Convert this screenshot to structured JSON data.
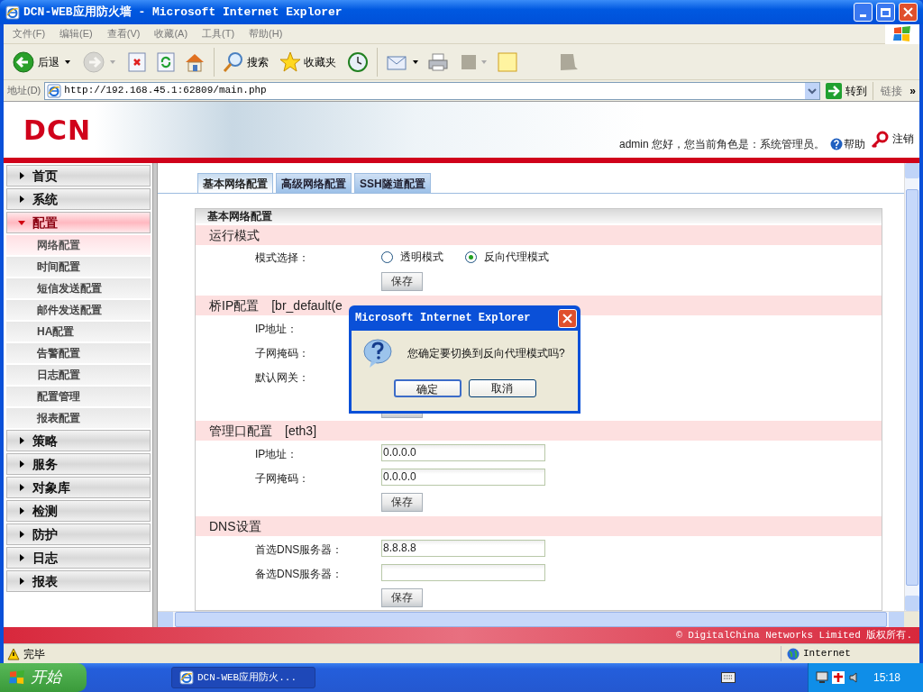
{
  "window": {
    "title": "DCN-WEB应用防火墙 - Microsoft Internet Explorer"
  },
  "menu_bar": [
    "文件(F)",
    "编辑(E)",
    "查看(V)",
    "收藏(A)",
    "工具(T)",
    "帮助(H)"
  ],
  "toolbar": {
    "back": "后退",
    "forward": {
      "disabled": true
    },
    "search": "搜索",
    "favorites": "收藏夹"
  },
  "address_bar": {
    "label": "地址(D)",
    "url": "http://192.168.45.1:62809/main.php",
    "go": "转到",
    "links": "链接",
    "more": "»"
  },
  "header": {
    "logo": "DCN",
    "user_text": "admin 您好，您当前角色是：系统管理员。",
    "help": "帮助",
    "logout": "注销"
  },
  "sidebar": {
    "items": [
      {
        "label": "首页",
        "expanded": false
      },
      {
        "label": "系统",
        "expanded": false
      },
      {
        "label": "配置",
        "expanded": true,
        "children": [
          {
            "label": "网络配置",
            "selected": true
          },
          {
            "label": "时间配置",
            "selected": false
          },
          {
            "label": "短信发送配置",
            "selected": false
          },
          {
            "label": "邮件发送配置",
            "selected": false
          },
          {
            "label": "HA配置",
            "selected": false
          },
          {
            "label": "告警配置",
            "selected": false
          },
          {
            "label": "日志配置",
            "selected": false
          },
          {
            "label": "配置管理",
            "selected": false
          },
          {
            "label": "报表配置",
            "selected": false
          }
        ]
      },
      {
        "label": "策略",
        "expanded": false
      },
      {
        "label": "服务",
        "expanded": false
      },
      {
        "label": "对象库",
        "expanded": false
      },
      {
        "label": "检测",
        "expanded": false
      },
      {
        "label": "防护",
        "expanded": false
      },
      {
        "label": "日志",
        "expanded": false
      },
      {
        "label": "报表",
        "expanded": false
      }
    ]
  },
  "tabs": [
    {
      "label": "基本网络配置",
      "selected": true
    },
    {
      "label": "高级网络配置",
      "selected": false
    },
    {
      "label": "SSH隧道配置",
      "selected": false
    }
  ],
  "panel": {
    "title": "基本网络配置",
    "sections": [
      {
        "heading": "运行模式",
        "rows": [
          {
            "kind": "radio",
            "label": "模式选择：",
            "options": [
              {
                "label": "透明模式",
                "selected": false
              },
              {
                "label": "反向代理模式",
                "selected": true
              }
            ]
          },
          {
            "kind": "button",
            "label": "保存"
          }
        ]
      },
      {
        "heading": "桥IP配置　[br_default(e",
        "rows": [
          {
            "kind": "label",
            "label": "IP地址："
          },
          {
            "kind": "label",
            "label": "子网掩码："
          },
          {
            "kind": "label",
            "label": "默认网关："
          },
          {
            "kind": "button"
          }
        ]
      },
      {
        "heading": "管理口配置　[eth3]",
        "rows": [
          {
            "kind": "field",
            "label": "IP地址：",
            "value": "0.0.0.0"
          },
          {
            "kind": "field",
            "label": "子网掩码：",
            "value": "0.0.0.0"
          },
          {
            "kind": "button",
            "label": "保存"
          }
        ]
      },
      {
        "heading": "DNS设置",
        "rows": [
          {
            "kind": "field",
            "label": "首选DNS服务器：",
            "value": "8.8.8.8"
          },
          {
            "kind": "field",
            "label": "备选DNS服务器："
          },
          {
            "kind": "button",
            "label": "保存"
          }
        ]
      }
    ]
  },
  "footer": "© DigitalChina Networks Limited 版权所有.",
  "status_bar": {
    "text": "完毕",
    "zone": "Internet"
  },
  "dialog": {
    "title": "Microsoft Internet Explorer",
    "message": "您确定要切换到反向代理模式吗?",
    "buttons": [
      {
        "label": "确定",
        "default": true
      },
      {
        "label": "取消",
        "default": false
      }
    ]
  },
  "taskbar": {
    "start": "开始",
    "tasks": [
      {
        "label": "DCN-WEB应用防火..."
      }
    ],
    "clock": "15:18"
  }
}
